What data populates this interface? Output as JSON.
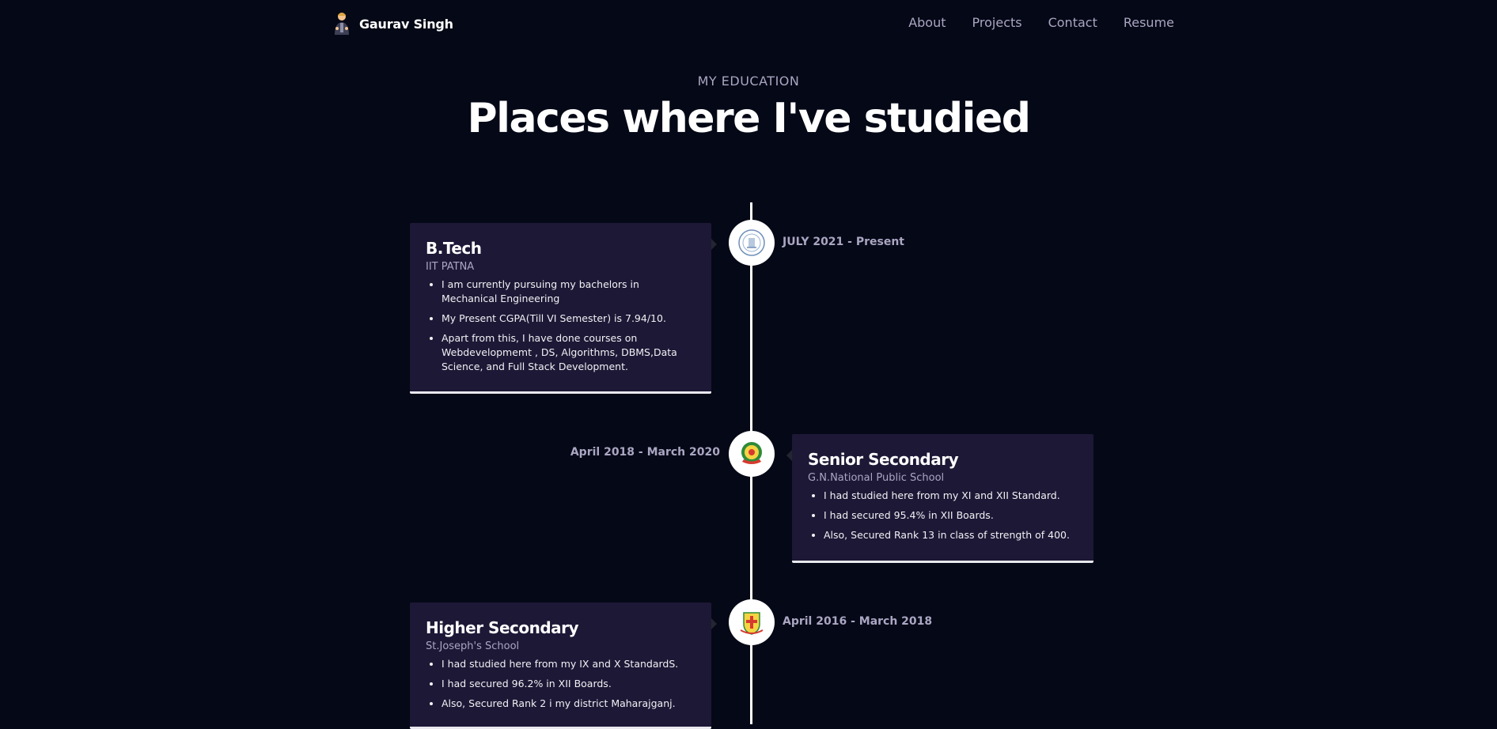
{
  "nav": {
    "brand_name": "Gaurav Singh",
    "links": [
      "About",
      "Projects",
      "Contact",
      "Resume"
    ]
  },
  "header": {
    "subtitle": "MY EDUCATION",
    "title": "Places where I've studied"
  },
  "timeline": [
    {
      "title": "B.Tech",
      "org": "IIT PATNA",
      "date": "JULY 2021 - Present",
      "points": [
        "I am currently pursuing my bachelors in Mechanical Engineering",
        "My Present CGPA(Till VI Semester) is 7.94/10.",
        "Apart from this, I have done courses on Webdevelopmemt , DS, Algorithms, DBMS,Data Science, and Full Stack Development."
      ],
      "logo_icon": "iit-patna-logo-icon"
    },
    {
      "title": "Senior Secondary",
      "org": "G.N.National Public School",
      "date": "April 2018 - March 2020",
      "points": [
        "I had studied here from my XI and XII Standard.",
        "I had secured 95.4% in XII Boards.",
        "Also, Secured Rank 13 in class of strength of 400."
      ],
      "logo_icon": "gn-national-school-logo-icon"
    },
    {
      "title": "Higher Secondary",
      "org": "St.Joseph's School",
      "date": "April 2016 - March 2018",
      "points": [
        "I had studied here from my IX and X StandardS.",
        "I had secured 96.2% in XII Boards.",
        "Also, Secured Rank 2 i my district Maharajganj."
      ],
      "logo_icon": "st-josephs-school-logo-icon"
    }
  ],
  "colors": {
    "background": "#050816",
    "card": "#1d1836",
    "muted_text": "#aaa6c3",
    "line": "#ffffff"
  }
}
